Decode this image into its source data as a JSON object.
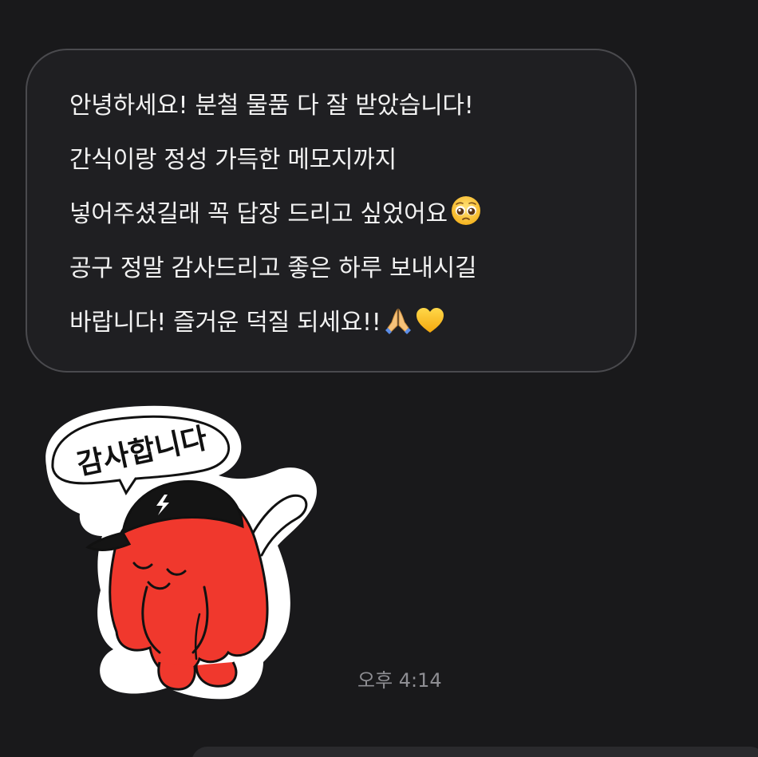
{
  "message": {
    "lines": [
      "안녕하세요! 분철 물품 다 잘 받았습니다!",
      "간식이랑 정성 가득한 메모지까지",
      "넣어주셨길래 꼭 답장 드리고 싶었어요",
      "공구 정말 감사드리고 좋은 하루 보내시길",
      "바랍니다! 즐거운 덕질 되세요!!"
    ],
    "emojis": [
      "pleading-face-icon",
      "folded-hands-icon",
      "yellow-heart-icon"
    ]
  },
  "sticker": {
    "text": "감사합니다",
    "character": "red blob character with black cap bowing"
  },
  "timestamp": "오후 4:14",
  "colors": {
    "background": "#19191b",
    "bubble_border": "#4a4a4e",
    "text": "#f2f2f2",
    "timestamp": "#8e8e93",
    "sticker_red": "#f0382d"
  }
}
